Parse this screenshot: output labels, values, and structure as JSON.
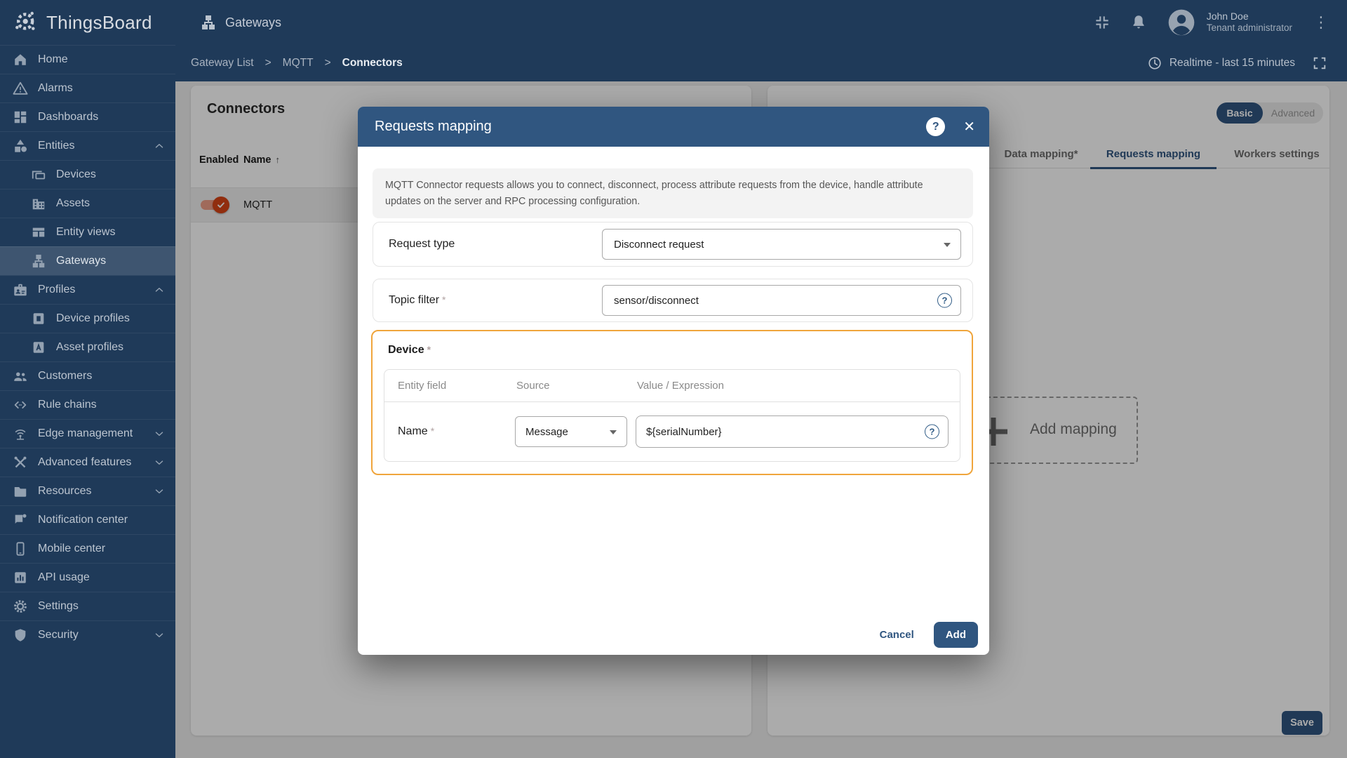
{
  "colors": {
    "navy": "#1f3a59",
    "primary": "#305680",
    "accent_orange": "#d84315",
    "highlight_border": "#f0a53c"
  },
  "icons": {
    "help": "?",
    "close": "✕",
    "more": "⋮",
    "sort_asc": "↑"
  },
  "brand": {
    "name": "ThingsBoard"
  },
  "header": {
    "page_title": "Gateways",
    "user": {
      "name": "John Doe",
      "role": "Tenant administrator"
    }
  },
  "breadcrumb": {
    "root": "Gateway List",
    "mid": "MQTT",
    "current": "Connectors",
    "separator": ">"
  },
  "timewindow": {
    "label": "Realtime - last 15 minutes"
  },
  "sidebar": {
    "items": [
      {
        "label": "Home"
      },
      {
        "label": "Alarms"
      },
      {
        "label": "Dashboards"
      },
      {
        "label": "Entities"
      },
      {
        "label": "Devices"
      },
      {
        "label": "Assets"
      },
      {
        "label": "Entity views"
      },
      {
        "label": "Gateways"
      },
      {
        "label": "Profiles"
      },
      {
        "label": "Device profiles"
      },
      {
        "label": "Asset profiles"
      },
      {
        "label": "Customers"
      },
      {
        "label": "Rule chains"
      },
      {
        "label": "Edge management"
      },
      {
        "label": "Advanced features"
      },
      {
        "label": "Resources"
      },
      {
        "label": "Notification center"
      },
      {
        "label": "Mobile center"
      },
      {
        "label": "API usage"
      },
      {
        "label": "Settings"
      },
      {
        "label": "Security"
      }
    ]
  },
  "connectors": {
    "title": "Connectors",
    "columns": {
      "enabled": "Enabled",
      "name": "Name"
    },
    "rows": [
      {
        "name": "MQTT",
        "enabled": true
      }
    ]
  },
  "config": {
    "modes": [
      "Basic",
      "Advanced"
    ],
    "active_mode": "Basic",
    "tabs": [
      "Data mapping*",
      "Requests mapping",
      "Workers settings"
    ],
    "active_tab": "Requests mapping",
    "add_mapping_label": "Add mapping",
    "save_label": "Save"
  },
  "modal": {
    "title": "Requests mapping",
    "description": "MQTT Connector requests allows you to connect, disconnect, process attribute requests from the device, handle attribute updates on the server and RPC processing configuration.",
    "request_type": {
      "label": "Request type",
      "value": "Disconnect request"
    },
    "topic_filter": {
      "label": "Topic filter",
      "required": "*",
      "value": "sensor/disconnect"
    },
    "device": {
      "label": "Device",
      "required": "*",
      "columns": [
        "Entity field",
        "Source",
        "Value / Expression"
      ],
      "row": {
        "field": "Name",
        "required": "*",
        "source": "Message",
        "value": "${serialNumber}"
      }
    },
    "cancel_label": "Cancel",
    "add_label": "Add"
  }
}
